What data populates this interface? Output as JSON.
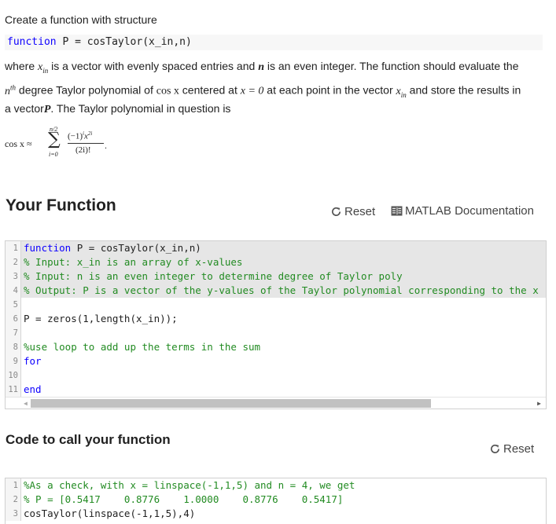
{
  "prompt": {
    "line1": "Create a function with structure",
    "signature_kw": "function",
    "signature_rest": " P = cosTaylor(x_in,n)",
    "line3_a": "where ",
    "x_in": "x",
    "x_in_sub": "in",
    "line3_b": " is a vector with evenly spaced entries and ",
    "n_var": "n",
    "line3_c": " is an even integer. The function should evaluate the",
    "nth": "n",
    "nth_sup": "th",
    "line4_a": " degree Taylor polynomial of ",
    "cosx": "cos x",
    "line4_b": " centered at ",
    "xeq0": "x = 0",
    "line4_c": " at each point in the vector ",
    "line4_d": " and store the results in",
    "line5_a": "a vector",
    "P_var": "P",
    "line5_b": ". The Taylor polynomial in question is",
    "formula_lhs": "cos x ≈",
    "formula_upper": "n/2",
    "formula_lower": "i=0",
    "formula_num": "(−1)",
    "formula_num_i": "i",
    "formula_num_x": "x",
    "formula_num_2i": "2i",
    "formula_den": "(2i)!"
  },
  "your_function": {
    "title": "Your Function",
    "reset_label": "Reset",
    "doc_label": "MATLAB Documentation",
    "lines": [
      {
        "n": "1",
        "kw": "function",
        "text": " P = cosTaylor(x_in,n)"
      },
      {
        "n": "2",
        "cm": "% Input: x_in is an array of x-values"
      },
      {
        "n": "3",
        "cm": "% Input: n is an even integer to determine degree of Taylor poly"
      },
      {
        "n": "4",
        "cm": "% Output: P is a vector of the y-values of the Taylor polynomial corresponding to the x"
      },
      {
        "n": "5",
        "text": ""
      },
      {
        "n": "6",
        "text": "P = zeros(1,length(x_in));"
      },
      {
        "n": "7",
        "text": ""
      },
      {
        "n": "8",
        "cm": "%use loop to add up the terms in the sum"
      },
      {
        "n": "9",
        "kw": "for",
        "text": ""
      },
      {
        "n": "10",
        "text": ""
      },
      {
        "n": "11",
        "kw": "end",
        "text": ""
      }
    ]
  },
  "call_function": {
    "title": "Code to call your function",
    "reset_label": "Reset",
    "lines": [
      {
        "n": "1",
        "cm": "%As a check, with x = linspace(-1,1,5) and n = 4, we get"
      },
      {
        "n": "2",
        "cm": "% P = [0.5417    0.8776    1.0000    0.8776    0.5417]"
      },
      {
        "n": "3",
        "text": "cosTaylor(linspace(-1,1,5),4)"
      }
    ]
  }
}
